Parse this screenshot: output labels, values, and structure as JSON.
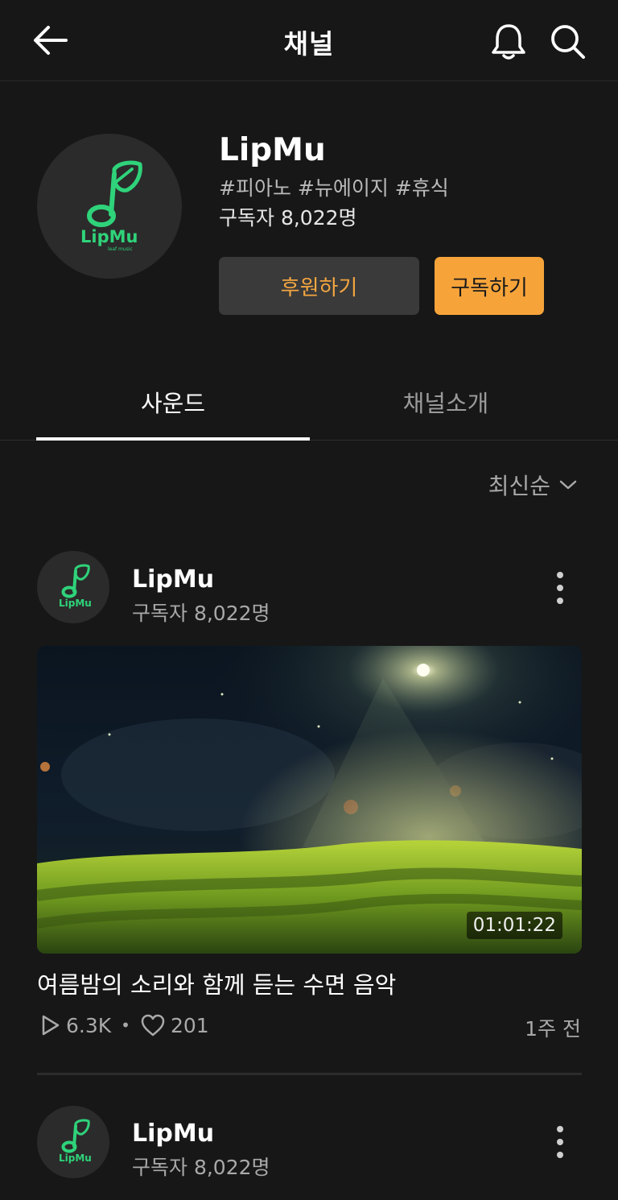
{
  "header": {
    "title": "채널"
  },
  "channel": {
    "name": "LipMu",
    "tags": "#피아노 #뉴에이지 #휴식",
    "subscribers": "구독자 8,022명",
    "logo_text": "LipMu",
    "logo_subtext": "leaf music",
    "sponsor_label": "후원하기",
    "subscribe_label": "구독하기",
    "accent_color": "#f6a43a",
    "logo_color": "#2fd37a"
  },
  "tabs": [
    {
      "label": "사운드",
      "active": true
    },
    {
      "label": "채널소개",
      "active": false
    }
  ],
  "sort": {
    "label": "최신순"
  },
  "posts": [
    {
      "author": "LipMu",
      "subscribers": "구독자 8,022명",
      "duration": "01:01:22",
      "title": "여름밤의 소리와 함께 듣는 수면 음악",
      "plays": "6.3K",
      "likes": "201",
      "time": "1주 전"
    },
    {
      "author": "LipMu",
      "subscribers": "구독자 8,022명"
    }
  ]
}
